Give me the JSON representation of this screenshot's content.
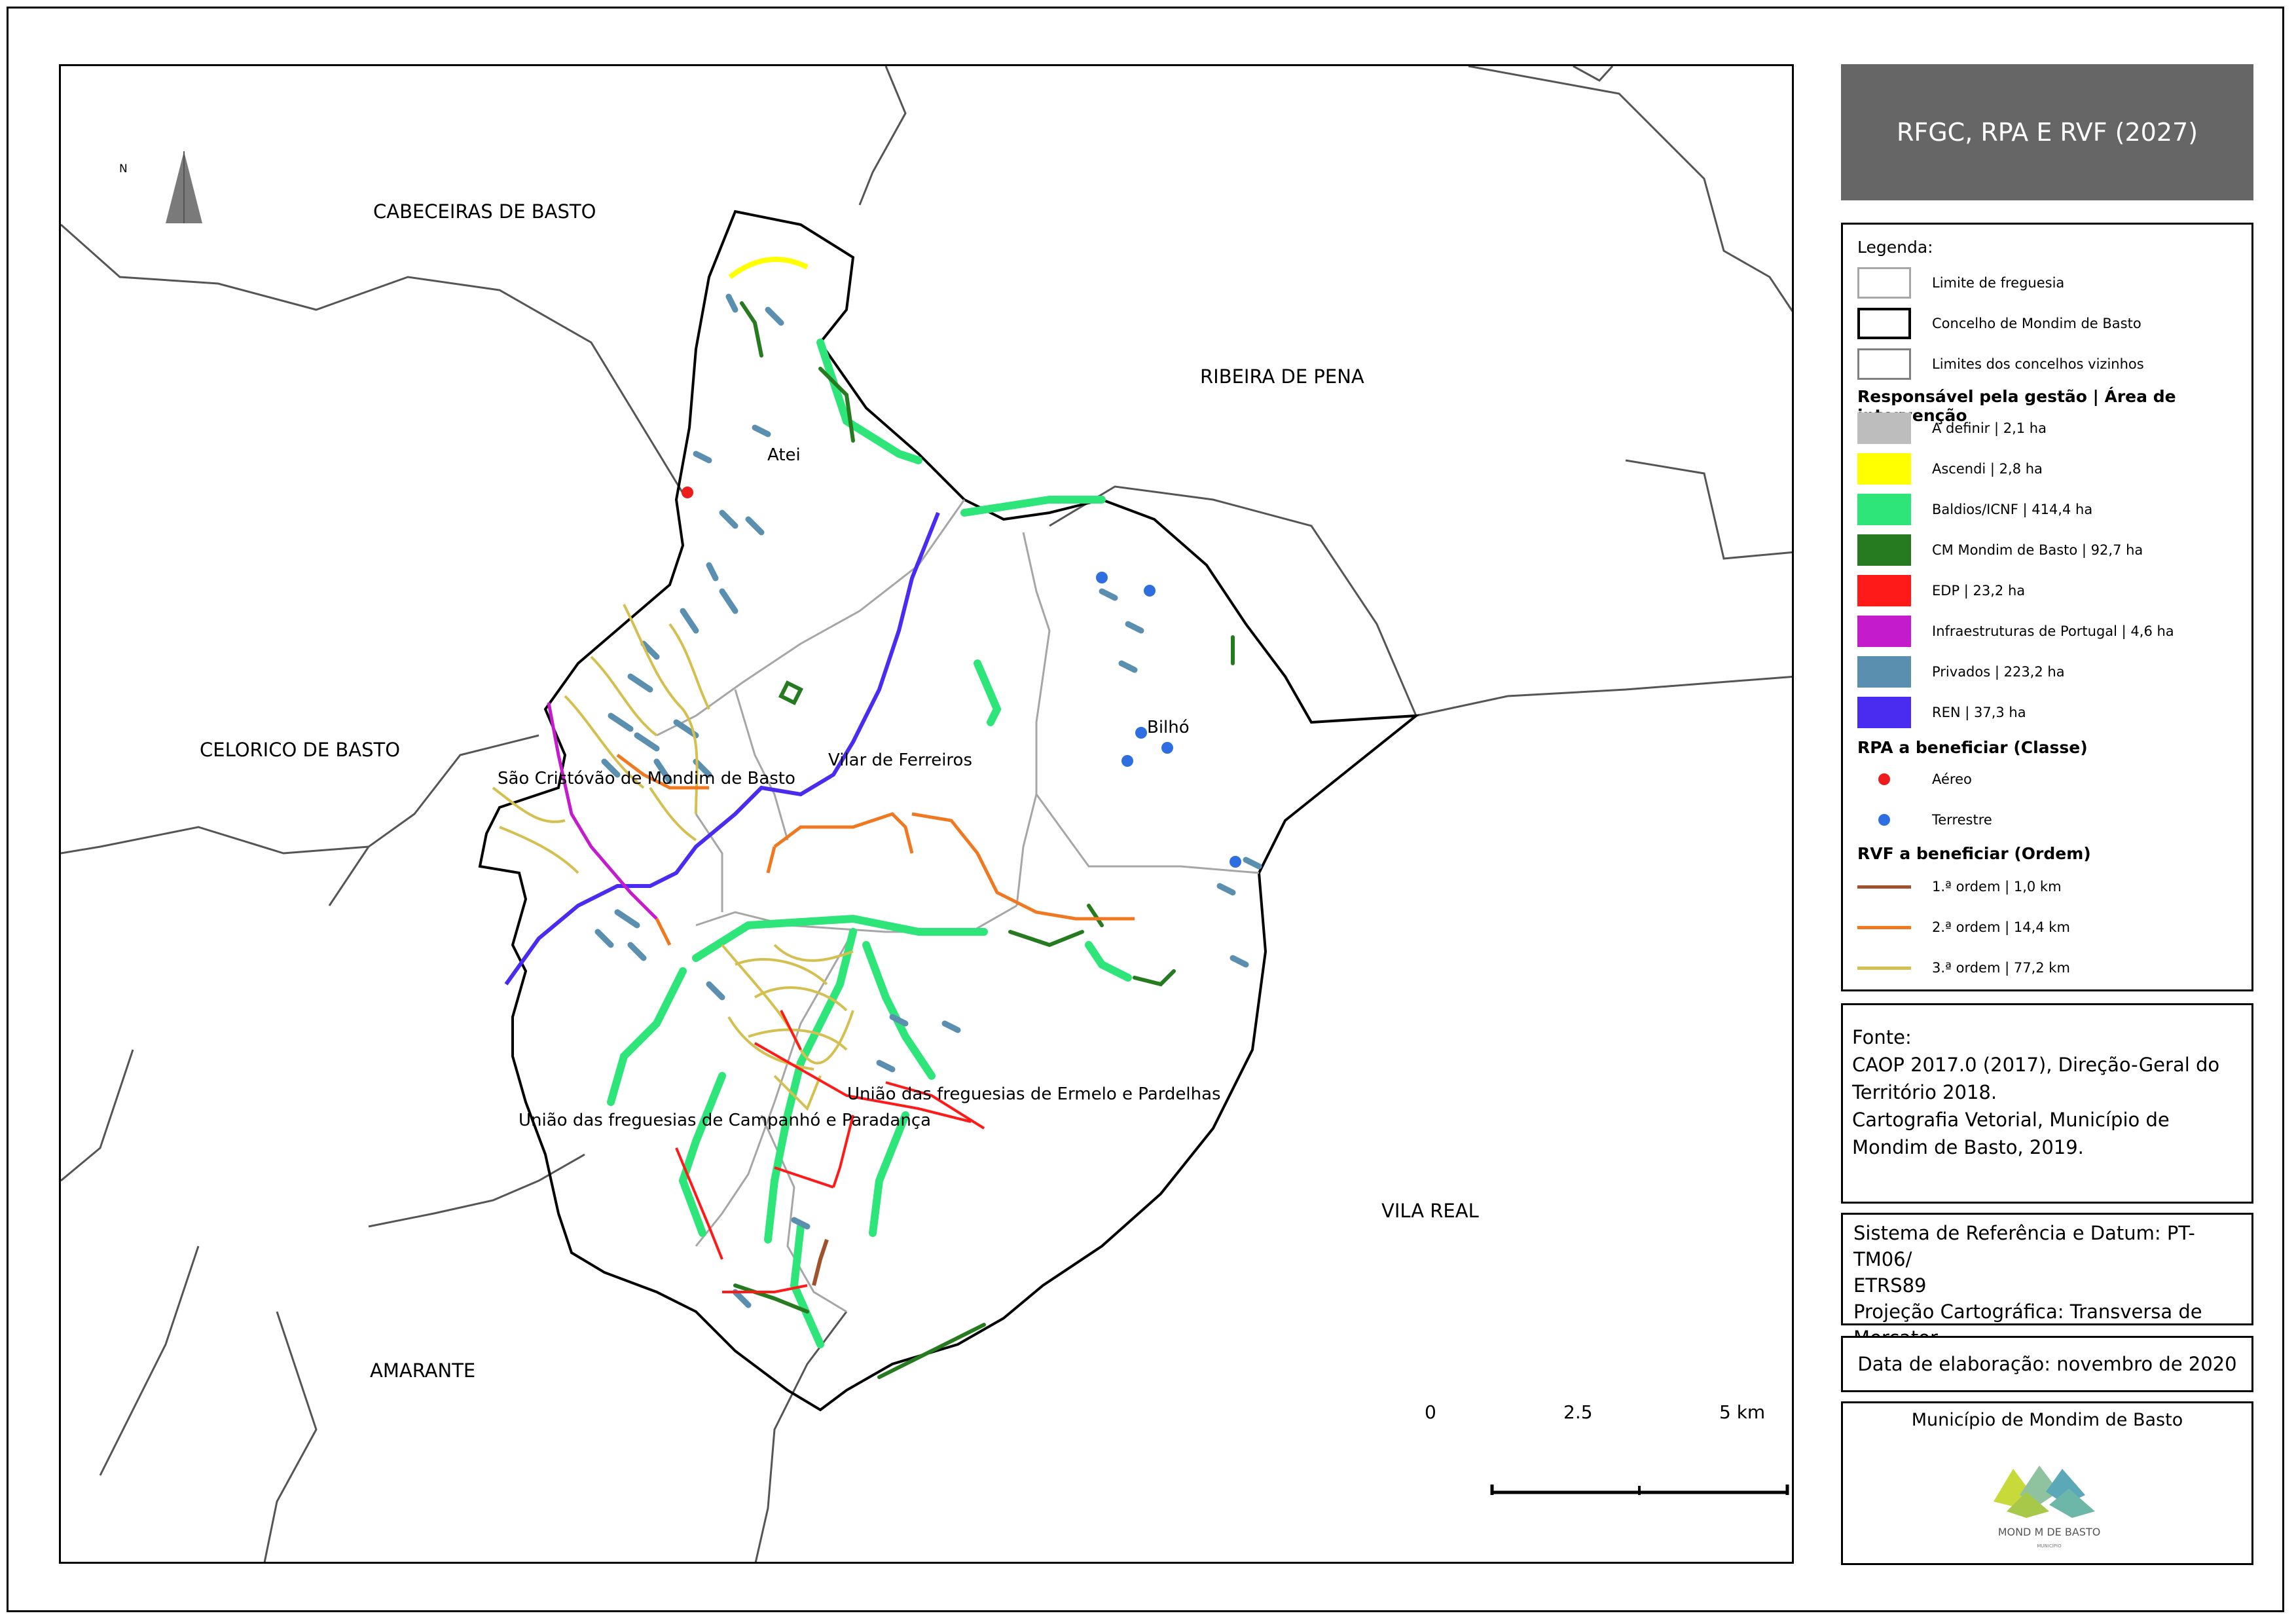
{
  "title": "RFGC, RPA E RVF (2027)",
  "map": {
    "neighbors": [
      "CABECEIRAS DE BASTO",
      "RIBEIRA DE PENA",
      "CELORICO DE BASTO",
      "VILA REAL",
      "AMARANTE"
    ],
    "parishes": [
      "Atei",
      "Bilhó",
      "Vilar de Ferreiros",
      "São Cristóvão de Mondim de Basto",
      "União das freguesias de Ermelo e Pardelhas",
      "União das freguesias de Campanhó e Paradança"
    ],
    "north_label": "N",
    "scale": {
      "ticks": [
        "0",
        "2.5",
        "5 km"
      ]
    }
  },
  "legend": {
    "heading": "Legenda:",
    "boundaries": [
      {
        "label": "Limite de freguesia",
        "border": "#a6a6a6"
      },
      {
        "label": "Concelho de Mondim de Basto",
        "border": "#000000"
      },
      {
        "label": "Limites dos concelhos vizinhos",
        "border": "#808080"
      }
    ],
    "management_title": "Responsável pela gestão | Área de intervenção",
    "management": [
      {
        "label": "A definir | 2,1 ha",
        "color": "#bdbdbd"
      },
      {
        "label": "Ascendi | 2,8 ha",
        "color": "#ffff00"
      },
      {
        "label": "Baldios/ICNF | 414,4 ha",
        "color": "#2ee57a"
      },
      {
        "label": "CM Mondim de Basto | 92,7 ha",
        "color": "#267a1f"
      },
      {
        "label": "EDP | 23,2 ha",
        "color": "#ff1a1a"
      },
      {
        "label": "Infraestruturas de Portugal | 4,6 ha",
        "color": "#c41ccc"
      },
      {
        "label": "Privados | 223,2 ha",
        "color": "#5a8fb0"
      },
      {
        "label": "REN | 37,3 ha",
        "color": "#4a2cf0"
      }
    ],
    "rpa_title": "RPA a beneficiar (Classe)",
    "rpa": [
      {
        "label": "Aéreo",
        "color": "#ee1c1c"
      },
      {
        "label": "Terrestre",
        "color": "#2f6ee0"
      }
    ],
    "rvf_title": "RVF a beneficiar (Ordem)",
    "rvf": [
      {
        "label": "1.ª ordem | 1,0 km",
        "color": "#a0522d"
      },
      {
        "label": "2.ª ordem | 14,4 km",
        "color": "#f07820"
      },
      {
        "label": "3.ª ordem | 77,2 km",
        "color": "#d4c050"
      }
    ]
  },
  "source": {
    "lines": [
      "Fonte:",
      "CAOP 2017.0 (2017), Direção-Geral do",
      "Território 2018.",
      "Cartografia Vetorial, Município de",
      "Mondim de Basto, 2019."
    ]
  },
  "srs": {
    "lines": [
      "Sistema de Referência e Datum: PT-TM06/",
      "ETRS89",
      "Projeção Cartográfica: Transversa de",
      "Mercator"
    ]
  },
  "date": "Data de elaboração: novembro de 2020",
  "organization": {
    "name": "Município de Mondim de Basto",
    "logo_text": "MOND M DE BASTO",
    "logo_subtext": "MUNICÍPIO"
  }
}
